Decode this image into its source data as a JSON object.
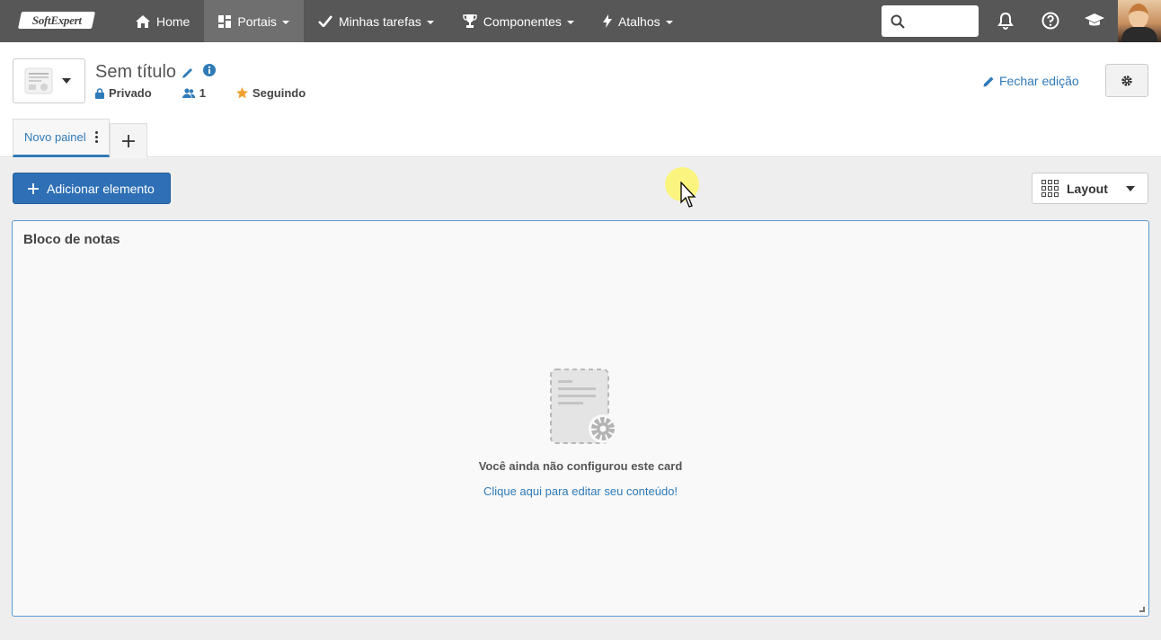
{
  "topbar": {
    "logo_text": "SoftExpert",
    "nav": [
      {
        "label": "Home",
        "icon": "home-icon"
      },
      {
        "label": "Portais",
        "icon": "dashboard-icon"
      },
      {
        "label": "Minhas tarefas",
        "icon": "check-icon"
      },
      {
        "label": "Componentes",
        "icon": "trophy-icon"
      },
      {
        "label": "Atalhos",
        "icon": "bolt-icon"
      }
    ],
    "search_placeholder": "",
    "icons": [
      "bell-icon",
      "help-icon",
      "graduation-cap-icon"
    ]
  },
  "header": {
    "title": "Sem título",
    "meta": {
      "privacy": "Privado",
      "members": "1",
      "following": "Seguindo"
    },
    "close_edit": "Fechar edição"
  },
  "tabs": [
    {
      "label": "Novo painel",
      "active": true
    }
  ],
  "toolbar": {
    "add_element": "Adicionar elemento",
    "layout": "Layout"
  },
  "card": {
    "title": "Bloco de notas",
    "empty_message": "Você ainda não configurou este card",
    "empty_link": "Clique aqui para editar seu conteúdo!"
  },
  "colors": {
    "topbar_bg": "#575757",
    "accent": "#2e6fb5",
    "link": "#2f7ab8",
    "star": "#f0a030"
  }
}
